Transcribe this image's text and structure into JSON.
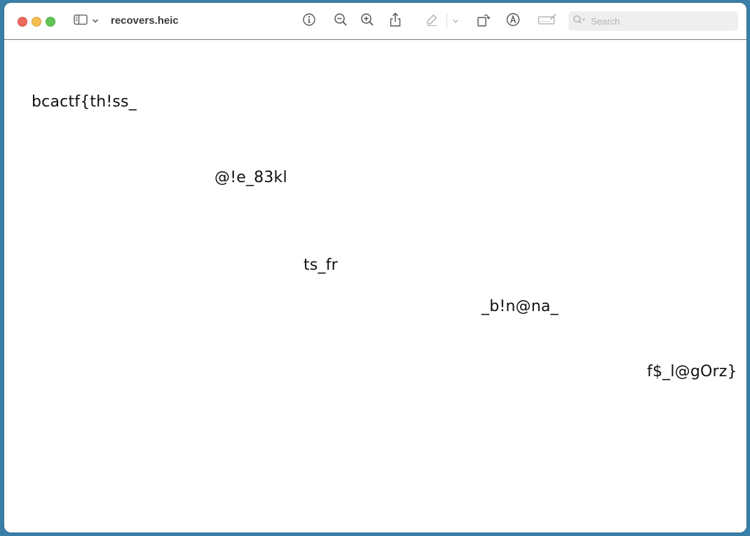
{
  "window": {
    "title": "recovers.heic"
  },
  "toolbar": {
    "search_placeholder": "Search",
    "icons": [
      "sidebar-icon",
      "chevron-down-icon",
      "info-icon",
      "zoom-out-icon",
      "zoom-in-icon",
      "share-icon",
      "highlight-pen-icon",
      "chevron-down-icon",
      "rotate-icon",
      "markup-icon",
      "signature-icon",
      "search-icon"
    ]
  },
  "image_text": {
    "fragment_1": "bcactf{th!ss_",
    "fragment_2": "@!e_83kl",
    "fragment_3": "ts_fr",
    "fragment_4": "_b!n@na_",
    "fragment_5": "f$_l@gOrz}"
  },
  "colors": {
    "desktop": "#3a7fa8",
    "close": "#ed6a5e",
    "minimize": "#f4bf4f",
    "maximize": "#61c554"
  }
}
